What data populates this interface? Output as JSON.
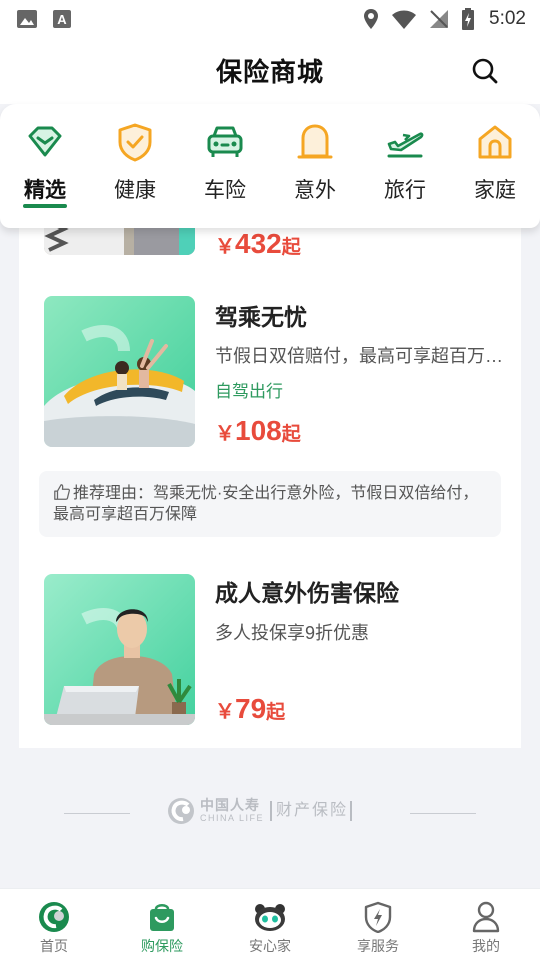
{
  "status_bar": {
    "time": "5:02",
    "left_icons": [
      "image-icon",
      "keyboard-a-icon"
    ],
    "right_icons": [
      "location-icon",
      "wifi-icon",
      "no-signal-icon",
      "battery-charging-icon"
    ]
  },
  "header": {
    "title": "保险商城",
    "search_icon": "search-icon"
  },
  "tabs": [
    {
      "label": "精选",
      "icon": "diamond-icon",
      "active": true
    },
    {
      "label": "健康",
      "icon": "shield-check-icon",
      "active": false
    },
    {
      "label": "车险",
      "icon": "car-icon",
      "active": false
    },
    {
      "label": "意外",
      "icon": "bell-arch-icon",
      "active": false
    },
    {
      "label": "旅行",
      "icon": "plane-icon",
      "active": false
    },
    {
      "label": "家庭",
      "icon": "home-icon",
      "active": false
    }
  ],
  "products": [
    {
      "price_symbol": "￥",
      "price": "432",
      "price_suffix": "起"
    },
    {
      "title": "驾乘无忧",
      "desc": "节假日双倍赔付，最高可享超百万保障",
      "tag": "自驾出行",
      "price_symbol": "￥",
      "price": "108",
      "price_suffix": "起"
    },
    {
      "title": "成人意外伤害保险",
      "desc": "多人投保享9折优惠",
      "price_symbol": "￥",
      "price": "79",
      "price_suffix": "起"
    }
  ],
  "recommend": {
    "text": "推荐理由：驾乘无忧·安全出行意外险，节假日双倍给付，最高可享超百万保障"
  },
  "footer": {
    "brand_cn": "中国人寿",
    "brand_en": "CHINA LIFE",
    "brand_sub": "财产保险"
  },
  "bottom_nav": [
    {
      "label": "首页",
      "icon": "home-logo-icon",
      "active": false
    },
    {
      "label": "购保险",
      "icon": "shopping-bag-icon",
      "active": true
    },
    {
      "label": "安心家",
      "icon": "panda-icon",
      "active": false
    },
    {
      "label": "享服务",
      "icon": "shield-bolt-icon",
      "active": false
    },
    {
      "label": "我的",
      "icon": "user-icon",
      "active": false
    }
  ],
  "colors": {
    "brand_green": "#1a8a4e",
    "accent_orange": "#f5a623",
    "price_red": "#e84b3c",
    "tag_green": "#2e9a5f"
  }
}
